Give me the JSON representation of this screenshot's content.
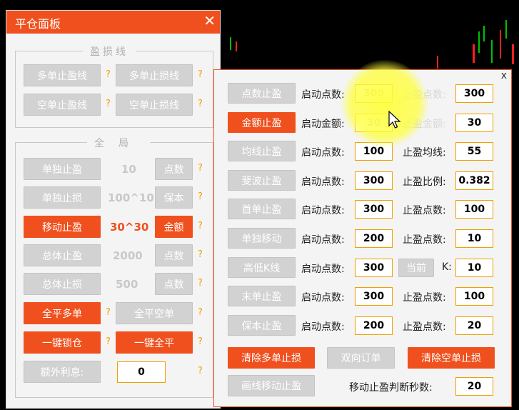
{
  "main_panel": {
    "title": "平仓面板",
    "close_label": "✕",
    "profit_loss_group": {
      "legend": "盈损线",
      "buttons": [
        "多单止盈线",
        "多单止损线",
        "空单止盈线",
        "空单止损线"
      ],
      "help": "?"
    },
    "global_group": {
      "legend": "全局",
      "rows": [
        {
          "button": "单独止盈",
          "value": "10",
          "unit": "点数"
        },
        {
          "button": "单独止损",
          "value": "100^10",
          "unit": "保本"
        },
        {
          "button": "移动止盈",
          "value": "30^30",
          "unit": "金额"
        },
        {
          "button": "总体止盈",
          "value": "2000",
          "unit": "点数"
        },
        {
          "button": "总体止损",
          "value": "500",
          "unit": "点数"
        }
      ],
      "close_all_buy": "全平多单",
      "close_all_sell": "全平空单",
      "lock": "一键锁仓",
      "close_all": "一键全平",
      "extra_interest_label": "额外利息:",
      "extra_interest_value": "0",
      "help": "?"
    }
  },
  "right_panel": {
    "close_label": "x",
    "rows": [
      {
        "button": "点数止盈",
        "l1": "启动点数:",
        "v1": "300",
        "l2": "止盈点数:",
        "v2": "300"
      },
      {
        "button": "金额止盈",
        "l1": "启动金额:",
        "v1": "30",
        "l2": "止盈金额:",
        "v2": "30"
      },
      {
        "button": "均线止盈",
        "l1": "启动点数:",
        "v1": "100",
        "l2": "止盈均线:",
        "v2": "55"
      },
      {
        "button": "斐波止盈",
        "l1": "启动点数:",
        "v1": "300",
        "l2": "止盈比例:",
        "v2": "0.382"
      },
      {
        "button": "首单止盈",
        "l1": "启动点数:",
        "v1": "300",
        "l2": "止盈点数:",
        "v2": "100"
      },
      {
        "button": "单独移动",
        "l1": "启动点数:",
        "v1": "200",
        "l2": "止盈点数:",
        "v2": "10"
      },
      {
        "button": "高低K线",
        "l1": "启动点数:",
        "v1": "300",
        "l2": "K:",
        "v2": "10",
        "extra_button": "当前"
      },
      {
        "button": "末单止盈",
        "l1": "启动点数:",
        "v1": "300",
        "l2": "止盈点数:",
        "v2": "100"
      },
      {
        "button": "保本止盈",
        "l1": "启动点数:",
        "v1": "200",
        "l2": "止盈点数:",
        "v2": "20"
      }
    ],
    "clear_buy_sl": "清除多单止损",
    "bidirectional": "双向订单",
    "clear_sell_sl": "清除空单止损",
    "draw_trailing": "画线移动止盈",
    "trail_seconds_label": "移动止盈判断秒数:",
    "trail_seconds_value": "20"
  },
  "colors": {
    "accent": "#f0501e",
    "box_border": "#f0a000",
    "candle_up": "#00c000",
    "candle_down": "#ff2020"
  }
}
